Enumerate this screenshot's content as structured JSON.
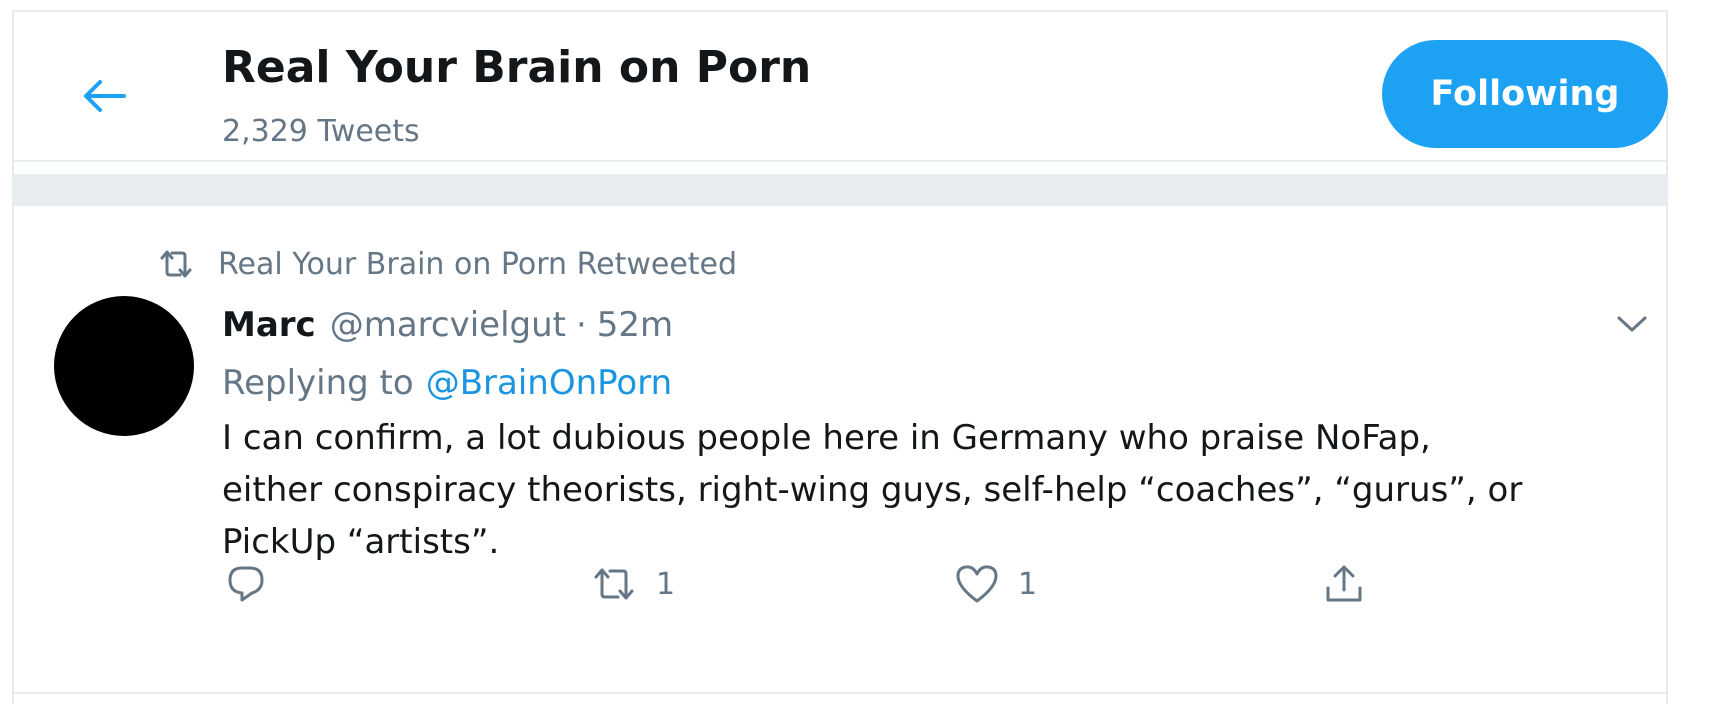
{
  "header": {
    "title": "Real Your Brain on Porn",
    "tweet_count": "2,329 Tweets",
    "follow_label": "Following",
    "back_icon": "arrow-left-icon"
  },
  "tweet": {
    "social_context": "Real Your Brain on Porn Retweeted",
    "author_name": "Marc",
    "author_handle": "@marcvielgut",
    "separator": "·",
    "time": "52m",
    "replying_prefix": "Replying to",
    "replying_to": "@BrainOnPorn",
    "text_lines": [
      "I can confirm, a lot dubious people here in Germany who praise NoFap,",
      "either conspiracy theorists, right-wing guys, self-help “coaches”, “gurus”, or",
      "PickUp “artists”."
    ],
    "actions": {
      "reply_count": "",
      "retweet_count": "1",
      "like_count": "1"
    }
  },
  "colors": {
    "accent": "#1da1f2",
    "link": "#1b95e0",
    "secondary_text": "#657786",
    "divider": "#e6ecf0"
  }
}
